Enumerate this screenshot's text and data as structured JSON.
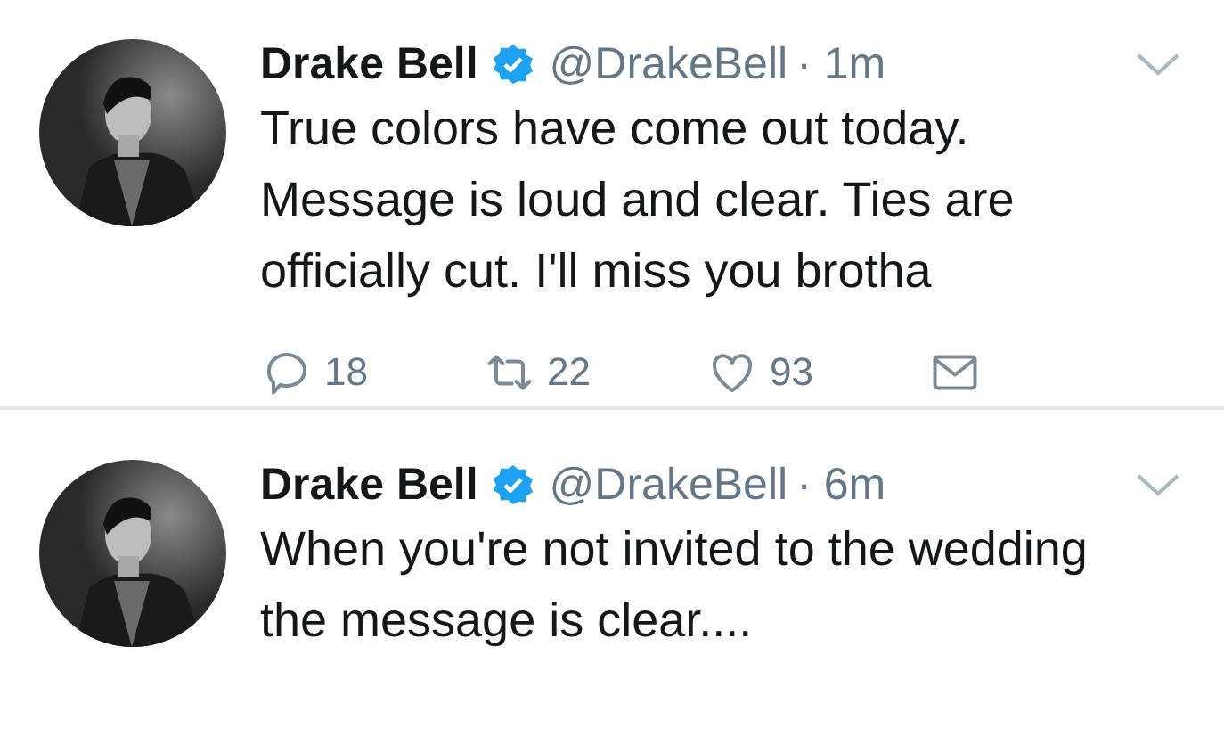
{
  "tweets": [
    {
      "name": "Drake Bell",
      "verified": true,
      "handle": "@DrakeBell",
      "time": "· 1m",
      "text": "True colors have come out today. Message is loud and clear. Ties are officially cut. I'll miss you brotha",
      "replies": "18",
      "retweets": "22",
      "likes": "93"
    },
    {
      "name": "Drake Bell",
      "verified": true,
      "handle": "@DrakeBell",
      "time": "· 6m",
      "text": "When you're not invited to the wedding the message is clear...."
    }
  ]
}
